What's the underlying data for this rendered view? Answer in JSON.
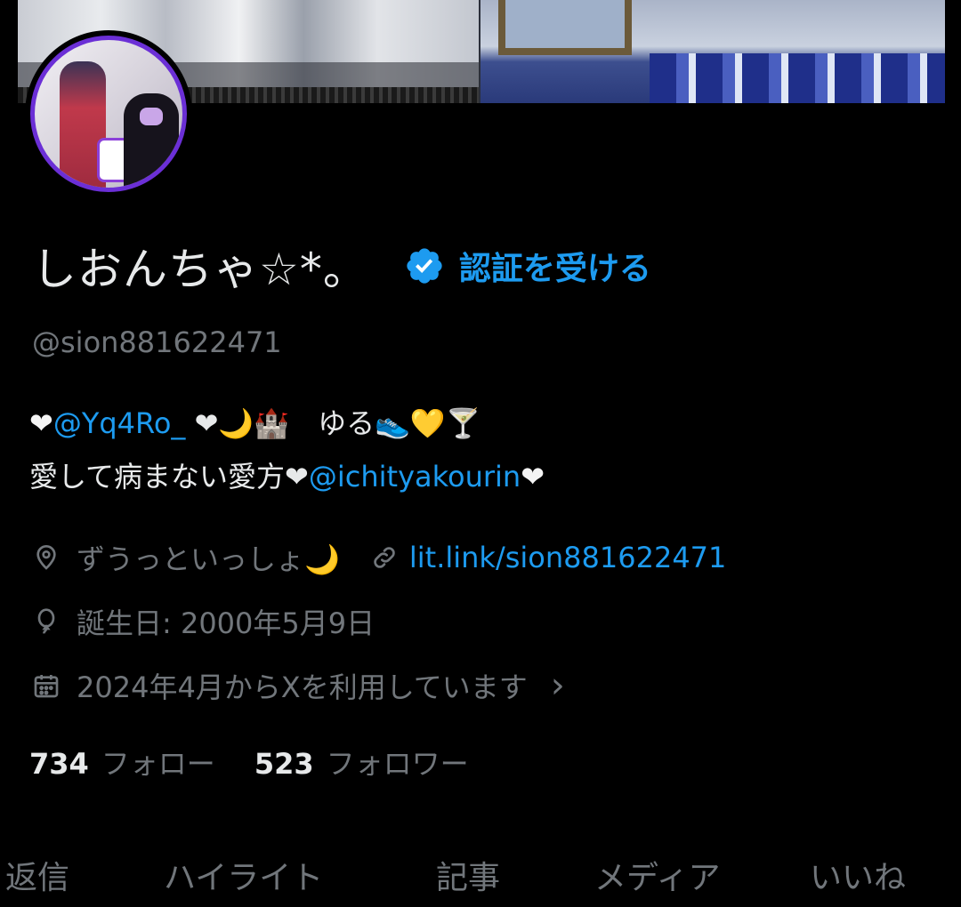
{
  "profile": {
    "display_name": "しおんちゃ☆*。",
    "verify_cta": "認証を受ける",
    "handle": "@sion881622471"
  },
  "bio": {
    "line1": [
      {
        "kind": "text",
        "text": "❤"
      },
      {
        "kind": "mention",
        "text": "@Yq4Ro_"
      },
      {
        "kind": "text",
        "text": " ❤🌙🏰　ゆる👟💛🍸"
      }
    ],
    "line2": [
      {
        "kind": "text",
        "text": "愛して病まない愛方❤"
      },
      {
        "kind": "mention",
        "text": "@ichityakourin"
      },
      {
        "kind": "text",
        "text": "❤"
      }
    ]
  },
  "meta": {
    "location": "ずうっといっしょ🌙",
    "website": "lit.link/sion881622471",
    "birthday": "誕生日: 2000年5月9日",
    "joined": "2024年4月からXを利用しています",
    "joined_chevron": "›"
  },
  "stats": {
    "following_count": "734",
    "following_label": "フォロー",
    "followers_count": "523",
    "followers_label": "フォロワー"
  },
  "tabs": [
    "返信",
    "ハイライト",
    "記事",
    "メディア",
    "いいね"
  ],
  "colors": {
    "background": "#000000",
    "accent_blue": "#1d9bf0",
    "muted": "#71767b",
    "text": "#e7e9ea",
    "avatar_ring": "#6b2fd6"
  },
  "icons": {
    "verify": "verified-badge-icon",
    "location": "location-pin-icon",
    "website": "link-icon",
    "birthday": "balloon-icon",
    "joined": "calendar-icon"
  }
}
